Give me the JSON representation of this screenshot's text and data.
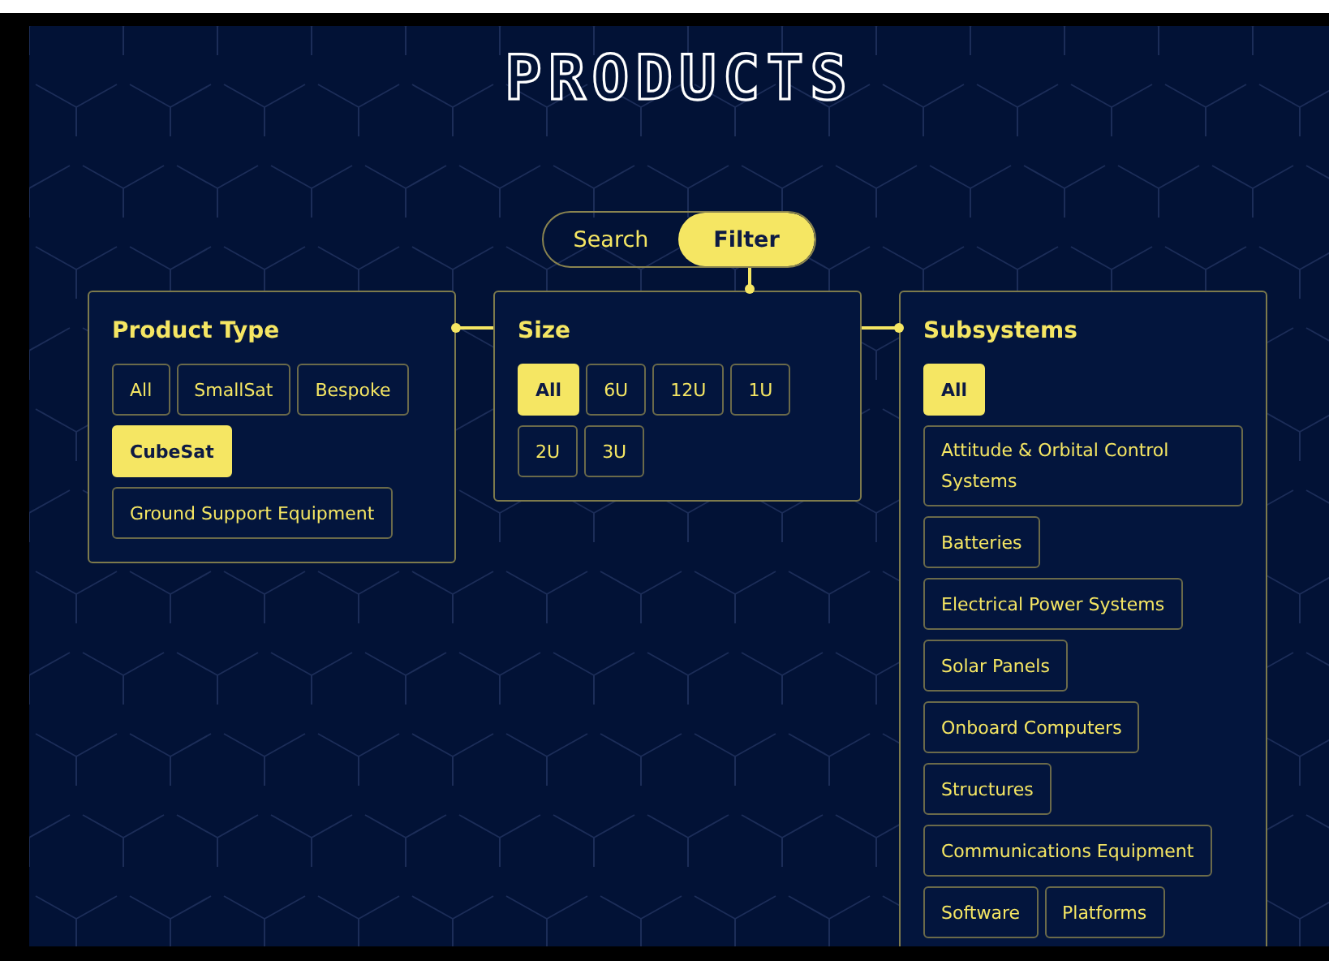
{
  "title": "PRODUCTS",
  "mode_tabs": [
    {
      "label": "Search",
      "selected": false
    },
    {
      "label": "Filter",
      "selected": true
    }
  ],
  "filter_groups": [
    {
      "title": "Product Type",
      "options": [
        {
          "label": "All",
          "selected": false
        },
        {
          "label": "SmallSat",
          "selected": false
        },
        {
          "label": "Bespoke",
          "selected": false
        },
        {
          "label": "CubeSat",
          "selected": true
        },
        {
          "label": "Ground Support Equipment",
          "selected": false
        }
      ]
    },
    {
      "title": "Size",
      "options": [
        {
          "label": "All",
          "selected": true
        },
        {
          "label": "6U",
          "selected": false
        },
        {
          "label": "12U",
          "selected": false
        },
        {
          "label": "1U",
          "selected": false
        },
        {
          "label": "2U",
          "selected": false
        },
        {
          "label": "3U",
          "selected": false
        }
      ]
    },
    {
      "title": "Subsystems",
      "options": [
        {
          "label": "All",
          "selected": true
        },
        {
          "label": "Attitude & Orbital Control Systems",
          "selected": false
        },
        {
          "label": "Batteries",
          "selected": false
        },
        {
          "label": "Electrical Power Systems",
          "selected": false
        },
        {
          "label": "Solar Panels",
          "selected": false
        },
        {
          "label": "Onboard Computers",
          "selected": false
        },
        {
          "label": "Structures",
          "selected": false
        },
        {
          "label": "Communications Equipment",
          "selected": false
        },
        {
          "label": "Software",
          "selected": false
        },
        {
          "label": "Platforms",
          "selected": false
        }
      ]
    }
  ]
}
